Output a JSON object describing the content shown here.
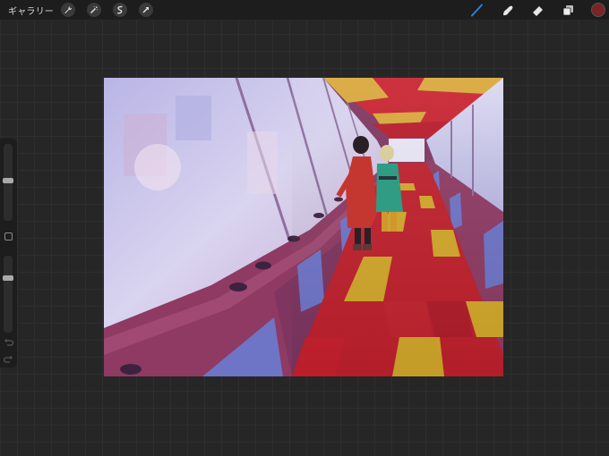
{
  "topbar": {
    "gallery_label": "ギャラリー",
    "left_tools": [
      "wrench-icon",
      "magic-wand-icon",
      "selection-icon",
      "transform-arrow-icon"
    ],
    "right_tools": [
      "brush-icon",
      "smudge-icon",
      "eraser-icon",
      "layers-icon"
    ],
    "current_color": "#7a2424",
    "active_tool_color": "#2f7de1"
  },
  "sidebar": {
    "brush_size_level": 0.52,
    "opacity_level": 0.72,
    "modify_icon": "square-icon",
    "undo_icon": "undo-icon",
    "redo_icon": "redo-icon"
  },
  "canvas": {
    "artwork": "illustration",
    "colors": {
      "window": "#c8c4e6",
      "wall": "#8e3a63",
      "floor_red": "#c0202c",
      "floor_yellow": "#d3a82a",
      "ceiling_red": "#c8222f",
      "ceiling_yellow": "#d8a73a"
    }
  }
}
